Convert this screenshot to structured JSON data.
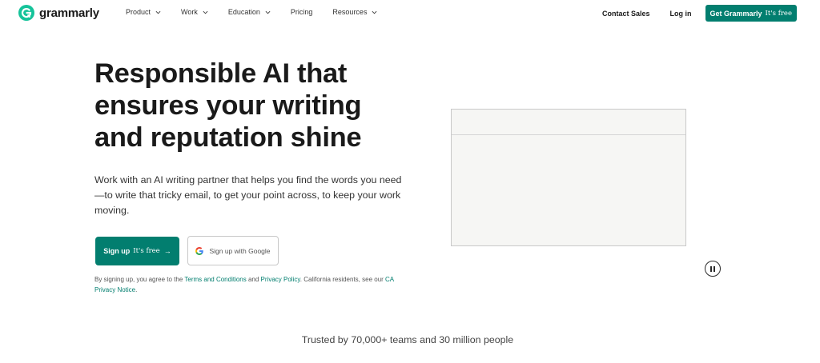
{
  "brand": {
    "name": "grammarly",
    "accent": "#15c39a",
    "primary": "#027e6f"
  },
  "nav": {
    "items": [
      {
        "label": "Product",
        "dropdown": true
      },
      {
        "label": "Work",
        "dropdown": true
      },
      {
        "label": "Education",
        "dropdown": true
      },
      {
        "label": "Pricing",
        "dropdown": false
      },
      {
        "label": "Resources",
        "dropdown": true
      }
    ],
    "contact_sales": "Contact Sales",
    "login": "Log in",
    "cta": {
      "label": "Get Grammarly",
      "sub": "It's free"
    }
  },
  "hero": {
    "title": "Responsible AI that ensures your writing and reputation shine",
    "subtitle": "Work with an AI writing partner that helps you find the words you need—to write that tricky email, to get your point across, to keep your work moving.",
    "signup": {
      "label": "Sign up",
      "sub": "It's free",
      "arrow": "→"
    },
    "google": {
      "label": "Sign up with Google"
    },
    "legal": {
      "prefix": "By signing up, you agree to the ",
      "terms": "Terms and Conditions",
      "and": " and ",
      "privacy": "Privacy Policy",
      "mid": ". California residents, see our ",
      "ca_notice": "CA Privacy Notice",
      "suffix": "."
    }
  },
  "trusted": "Trusted by 70,000+ teams and 30 million people"
}
